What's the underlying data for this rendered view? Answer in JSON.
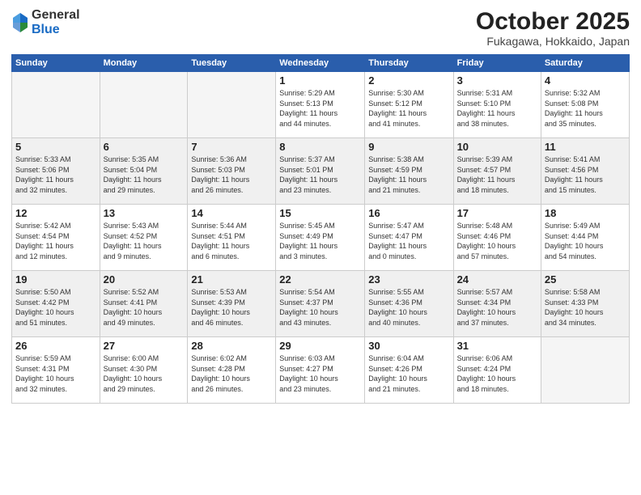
{
  "logo": {
    "general": "General",
    "blue": "Blue"
  },
  "title": "October 2025",
  "location": "Fukagawa, Hokkaido, Japan",
  "weekdays": [
    "Sunday",
    "Monday",
    "Tuesday",
    "Wednesday",
    "Thursday",
    "Friday",
    "Saturday"
  ],
  "weeks": [
    [
      {
        "day": "",
        "info": ""
      },
      {
        "day": "",
        "info": ""
      },
      {
        "day": "",
        "info": ""
      },
      {
        "day": "1",
        "info": "Sunrise: 5:29 AM\nSunset: 5:13 PM\nDaylight: 11 hours\nand 44 minutes."
      },
      {
        "day": "2",
        "info": "Sunrise: 5:30 AM\nSunset: 5:12 PM\nDaylight: 11 hours\nand 41 minutes."
      },
      {
        "day": "3",
        "info": "Sunrise: 5:31 AM\nSunset: 5:10 PM\nDaylight: 11 hours\nand 38 minutes."
      },
      {
        "day": "4",
        "info": "Sunrise: 5:32 AM\nSunset: 5:08 PM\nDaylight: 11 hours\nand 35 minutes."
      }
    ],
    [
      {
        "day": "5",
        "info": "Sunrise: 5:33 AM\nSunset: 5:06 PM\nDaylight: 11 hours\nand 32 minutes."
      },
      {
        "day": "6",
        "info": "Sunrise: 5:35 AM\nSunset: 5:04 PM\nDaylight: 11 hours\nand 29 minutes."
      },
      {
        "day": "7",
        "info": "Sunrise: 5:36 AM\nSunset: 5:03 PM\nDaylight: 11 hours\nand 26 minutes."
      },
      {
        "day": "8",
        "info": "Sunrise: 5:37 AM\nSunset: 5:01 PM\nDaylight: 11 hours\nand 23 minutes."
      },
      {
        "day": "9",
        "info": "Sunrise: 5:38 AM\nSunset: 4:59 PM\nDaylight: 11 hours\nand 21 minutes."
      },
      {
        "day": "10",
        "info": "Sunrise: 5:39 AM\nSunset: 4:57 PM\nDaylight: 11 hours\nand 18 minutes."
      },
      {
        "day": "11",
        "info": "Sunrise: 5:41 AM\nSunset: 4:56 PM\nDaylight: 11 hours\nand 15 minutes."
      }
    ],
    [
      {
        "day": "12",
        "info": "Sunrise: 5:42 AM\nSunset: 4:54 PM\nDaylight: 11 hours\nand 12 minutes."
      },
      {
        "day": "13",
        "info": "Sunrise: 5:43 AM\nSunset: 4:52 PM\nDaylight: 11 hours\nand 9 minutes."
      },
      {
        "day": "14",
        "info": "Sunrise: 5:44 AM\nSunset: 4:51 PM\nDaylight: 11 hours\nand 6 minutes."
      },
      {
        "day": "15",
        "info": "Sunrise: 5:45 AM\nSunset: 4:49 PM\nDaylight: 11 hours\nand 3 minutes."
      },
      {
        "day": "16",
        "info": "Sunrise: 5:47 AM\nSunset: 4:47 PM\nDaylight: 11 hours\nand 0 minutes."
      },
      {
        "day": "17",
        "info": "Sunrise: 5:48 AM\nSunset: 4:46 PM\nDaylight: 10 hours\nand 57 minutes."
      },
      {
        "day": "18",
        "info": "Sunrise: 5:49 AM\nSunset: 4:44 PM\nDaylight: 10 hours\nand 54 minutes."
      }
    ],
    [
      {
        "day": "19",
        "info": "Sunrise: 5:50 AM\nSunset: 4:42 PM\nDaylight: 10 hours\nand 51 minutes."
      },
      {
        "day": "20",
        "info": "Sunrise: 5:52 AM\nSunset: 4:41 PM\nDaylight: 10 hours\nand 49 minutes."
      },
      {
        "day": "21",
        "info": "Sunrise: 5:53 AM\nSunset: 4:39 PM\nDaylight: 10 hours\nand 46 minutes."
      },
      {
        "day": "22",
        "info": "Sunrise: 5:54 AM\nSunset: 4:37 PM\nDaylight: 10 hours\nand 43 minutes."
      },
      {
        "day": "23",
        "info": "Sunrise: 5:55 AM\nSunset: 4:36 PM\nDaylight: 10 hours\nand 40 minutes."
      },
      {
        "day": "24",
        "info": "Sunrise: 5:57 AM\nSunset: 4:34 PM\nDaylight: 10 hours\nand 37 minutes."
      },
      {
        "day": "25",
        "info": "Sunrise: 5:58 AM\nSunset: 4:33 PM\nDaylight: 10 hours\nand 34 minutes."
      }
    ],
    [
      {
        "day": "26",
        "info": "Sunrise: 5:59 AM\nSunset: 4:31 PM\nDaylight: 10 hours\nand 32 minutes."
      },
      {
        "day": "27",
        "info": "Sunrise: 6:00 AM\nSunset: 4:30 PM\nDaylight: 10 hours\nand 29 minutes."
      },
      {
        "day": "28",
        "info": "Sunrise: 6:02 AM\nSunset: 4:28 PM\nDaylight: 10 hours\nand 26 minutes."
      },
      {
        "day": "29",
        "info": "Sunrise: 6:03 AM\nSunset: 4:27 PM\nDaylight: 10 hours\nand 23 minutes."
      },
      {
        "day": "30",
        "info": "Sunrise: 6:04 AM\nSunset: 4:26 PM\nDaylight: 10 hours\nand 21 minutes."
      },
      {
        "day": "31",
        "info": "Sunrise: 6:06 AM\nSunset: 4:24 PM\nDaylight: 10 hours\nand 18 minutes."
      },
      {
        "day": "",
        "info": ""
      }
    ]
  ]
}
